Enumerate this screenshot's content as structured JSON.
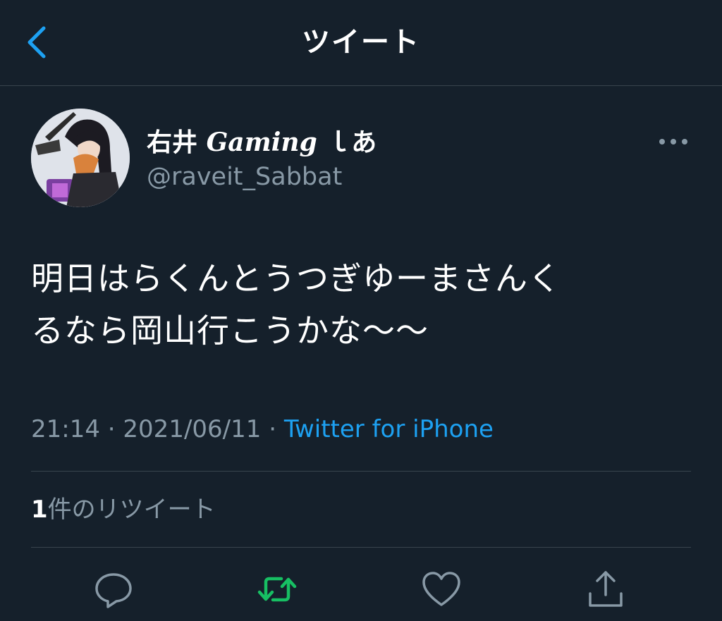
{
  "header": {
    "title": "ツイート"
  },
  "author": {
    "display_name_prefix": "右井",
    "display_name_gaming": "Gaming",
    "display_name_suffix": "ｌあ",
    "username": "@raveit_Sabbat"
  },
  "tweet": {
    "text_line1": "明日はらくんとうつぎゆーまさんく",
    "text_line2": "るなら岡山行こうかな〜〜",
    "time": "21:14",
    "sep1": "·",
    "date": "2021/06/11",
    "sep2": "·",
    "source": "Twitter for iPhone"
  },
  "stats": {
    "retweet_count": "1",
    "retweet_label": "件のリツイート"
  },
  "actions": {
    "icons": [
      "reply-icon",
      "retweet-icon",
      "like-icon",
      "share-icon"
    ],
    "retweeted": true
  },
  "colors": {
    "background": "#15202b",
    "accent": "#1da1f2",
    "retweet_active": "#17bf63",
    "secondary_text": "#8899a6",
    "divider": "#38444d"
  }
}
